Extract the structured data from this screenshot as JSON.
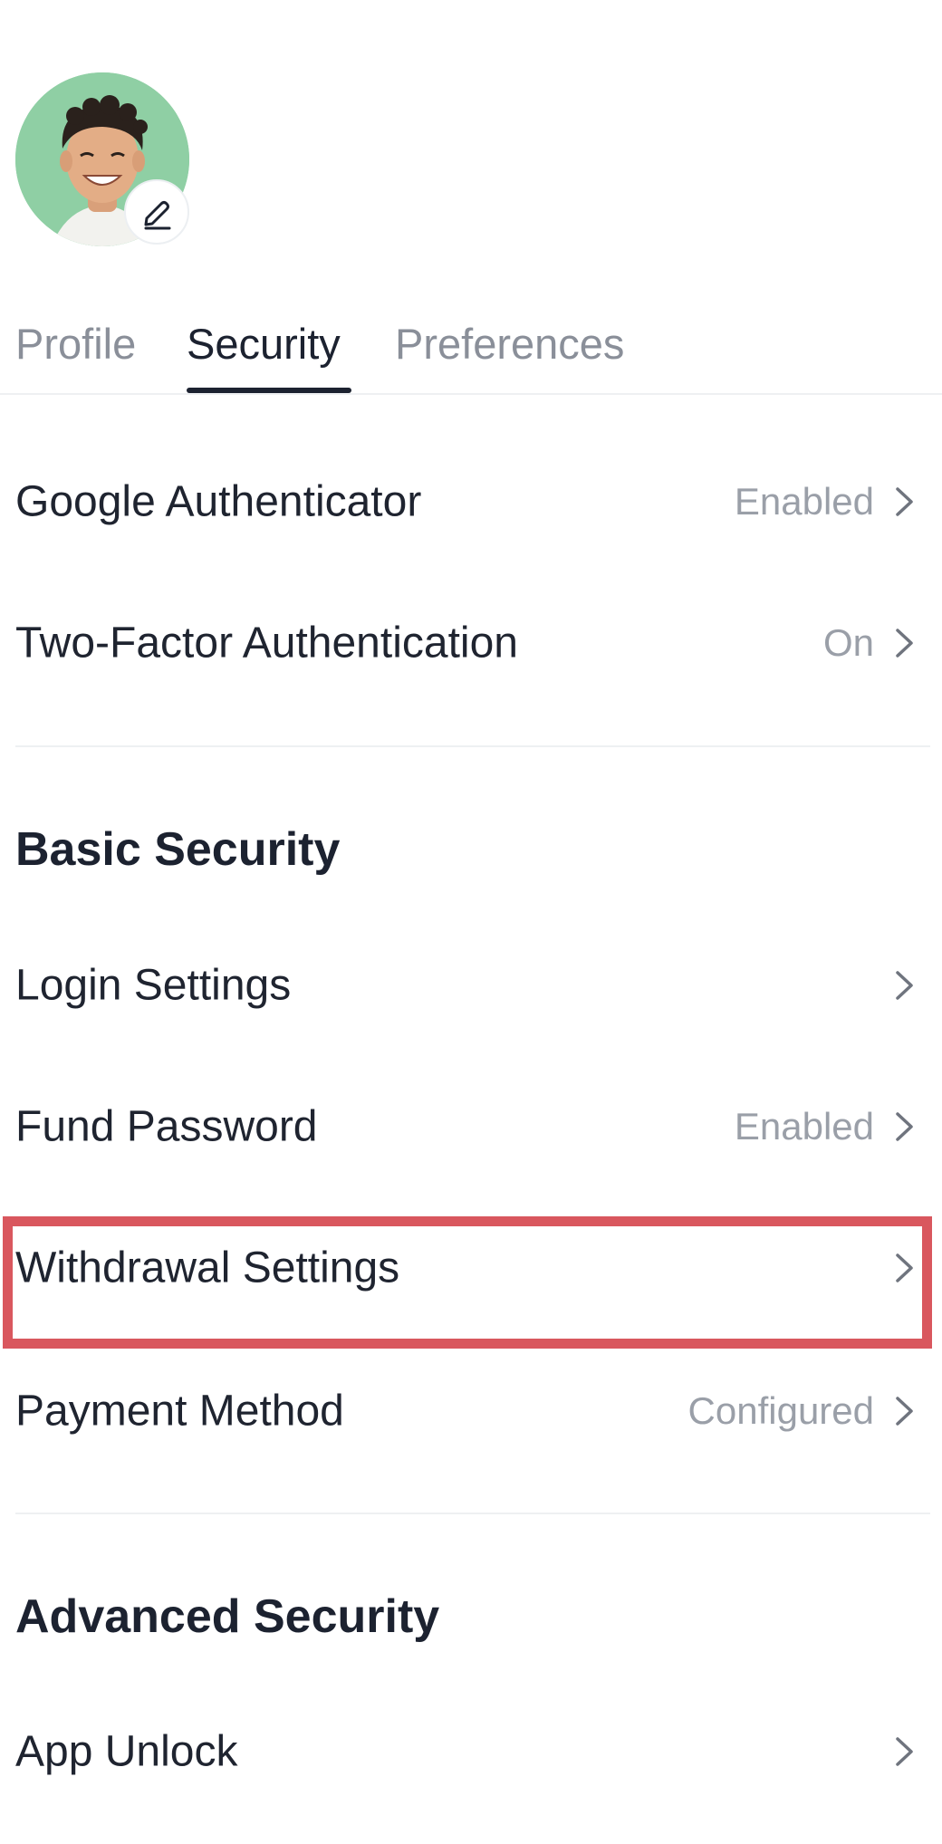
{
  "profile": {
    "avatar_alt": "User avatar",
    "edit_icon": "pencil-icon"
  },
  "tabs": [
    {
      "label": "Profile",
      "active": false
    },
    {
      "label": "Security",
      "active": true
    },
    {
      "label": "Preferences",
      "active": false
    }
  ],
  "top_items": [
    {
      "label": "Google Authenticator",
      "value": "Enabled"
    },
    {
      "label": "Two-Factor Authentication",
      "value": "On"
    }
  ],
  "basic_security": {
    "title": "Basic Security",
    "items": [
      {
        "label": "Login Settings",
        "value": ""
      },
      {
        "label": "Fund Password",
        "value": "Enabled"
      },
      {
        "label": "Withdrawal Settings",
        "value": "",
        "highlighted": true
      },
      {
        "label": "Payment Method",
        "value": "Configured"
      }
    ]
  },
  "advanced_security": {
    "title": "Advanced Security",
    "items": [
      {
        "label": "App Unlock",
        "value": ""
      }
    ]
  },
  "colors": {
    "text_primary": "#1c2230",
    "text_secondary": "#9a9fa8",
    "tab_inactive": "#8a8f99",
    "highlight_border": "#d9575e",
    "avatar_bg": "#8fcfa4",
    "divider": "#eef0f2"
  },
  "icons": {
    "chevron": "chevron-right-icon",
    "edit": "pencil-icon"
  }
}
